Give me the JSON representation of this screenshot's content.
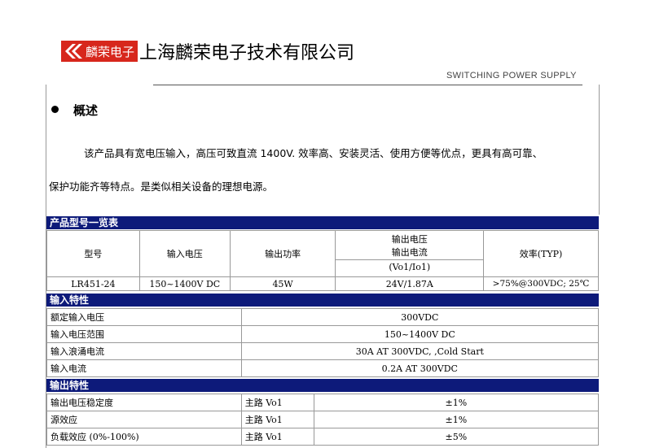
{
  "logo": {
    "badge_text": "麟荣电子",
    "company_name": "上海麟荣电子技术有限公司"
  },
  "subtitle": "SWITCHING POWER SUPPLY",
  "overview": {
    "title": "概述",
    "para1": "该产品具有宽电压输入，高压可致直流 1400V. 效率高、安装灵活、使用方便等优点，更具有高可靠、",
    "para2": "保护功能齐等特点。是类似相关设备的理想电源。"
  },
  "model_section": {
    "title": "产品型号一览表",
    "headers": {
      "model": "型号",
      "input_voltage": "输入电压",
      "output_power": "输出功率",
      "output_v": "输出电压",
      "output_i": "输出电流",
      "output_unit": "(Vo1/Io1)",
      "efficiency": "效率(TYP)"
    },
    "row": {
      "model": "LR451-24",
      "input_voltage": "150~1400V DC",
      "output_power": "45W",
      "output": "24V/1.87A",
      "efficiency": ">75%@300VDC; 25℃"
    }
  },
  "input_section": {
    "title": "输入特性",
    "rows": [
      {
        "label": "额定输入电压",
        "value": "300VDC"
      },
      {
        "label": "输入电压范围",
        "value": "150~1400V DC"
      },
      {
        "label": "输入浪涌电流",
        "value": "30A  AT 300VDC, ,Cold Start"
      },
      {
        "label": "输入电流",
        "value": "0.2A  AT 300VDC"
      }
    ]
  },
  "output_section": {
    "title": "输出特性",
    "rows": [
      {
        "label": "输出电压稳定度",
        "sub": "主路 Vo1",
        "value": "±1%"
      },
      {
        "label": "源效应",
        "sub": "主路 Vo1",
        "value": "±1%"
      },
      {
        "label": "负载效应 (0%-100%)",
        "sub": "主路 Vo1",
        "value": "±5%"
      }
    ]
  }
}
